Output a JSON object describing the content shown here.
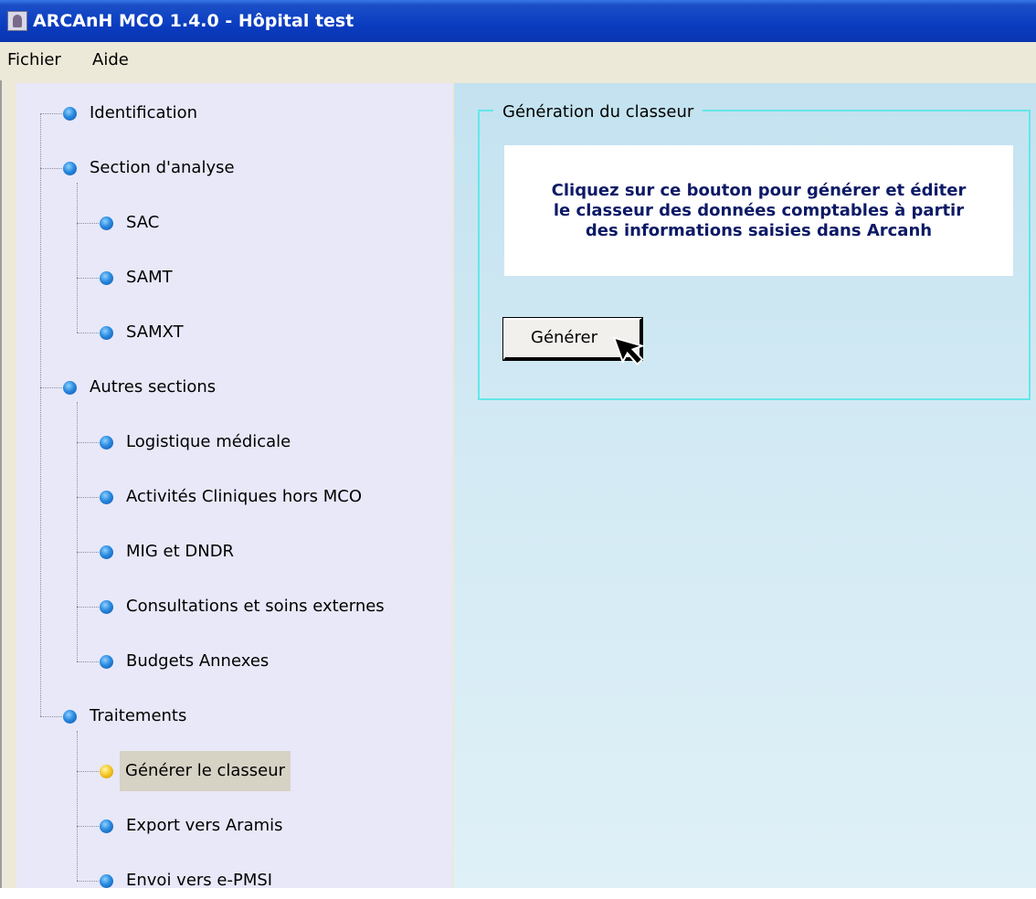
{
  "window": {
    "title": "ARCAnH MCO 1.4.0 - Hôpital test"
  },
  "menu": {
    "items": [
      "Fichier",
      "Aide"
    ]
  },
  "tree": {
    "identification": "Identification",
    "section_analyse": "Section d'analyse",
    "sac": "SAC",
    "samt": "SAMT",
    "samxt": "SAMXT",
    "autres_sections": "Autres sections",
    "logistique": "Logistique médicale",
    "activites": "Activités Cliniques hors MCO",
    "mig": "MIG et DNDR",
    "consultations": "Consultations et soins externes",
    "budgets": "Budgets Annexes",
    "traitements": "Traitements",
    "generer_classeur": "Générer le classeur",
    "export_aramis": "Export vers Aramis",
    "envoi_epmsi": "Envoi vers e-PMSI"
  },
  "panel": {
    "group_title": "Génération du classeur",
    "info_text": "Cliquez sur ce bouton pour générer et éditer\nle classeur des données comptables à partir\ndes informations saisies dans Arcanh",
    "generate_button": "Générer"
  },
  "colors": {
    "titlebar": "#0a3cc0",
    "tree_background": "#e8e8f8",
    "group_border": "#62e8e8",
    "info_text": "#0d1a66"
  },
  "icons": {
    "tree_bullet": "blue-sphere-icon",
    "tree_bullet_active": "yellow-sphere-icon"
  }
}
